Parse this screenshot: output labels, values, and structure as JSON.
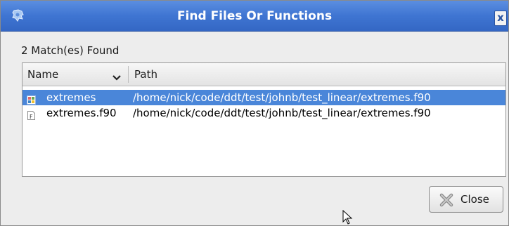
{
  "window": {
    "title": "Find Files Or Functions",
    "close_glyph": "x"
  },
  "summary": {
    "match_label": "2 Match(es) Found"
  },
  "list": {
    "columns": [
      {
        "label": "Name"
      },
      {
        "label": "Path"
      }
    ],
    "rows": [
      {
        "name": "extremes",
        "path": "/home/nick/code/ddt/test/johnb/test_linear/extremes.f90",
        "icon": "function-icon",
        "selected": true
      },
      {
        "name": "extremes.f90",
        "path": "/home/nick/code/ddt/test/johnb/test_linear/extremes.f90",
        "icon": "fortran-file-icon",
        "selected": false
      }
    ]
  },
  "buttons": {
    "close_label": "Close"
  },
  "colors": {
    "titlebar": "#3f75d2",
    "selection": "#4a86d9"
  }
}
